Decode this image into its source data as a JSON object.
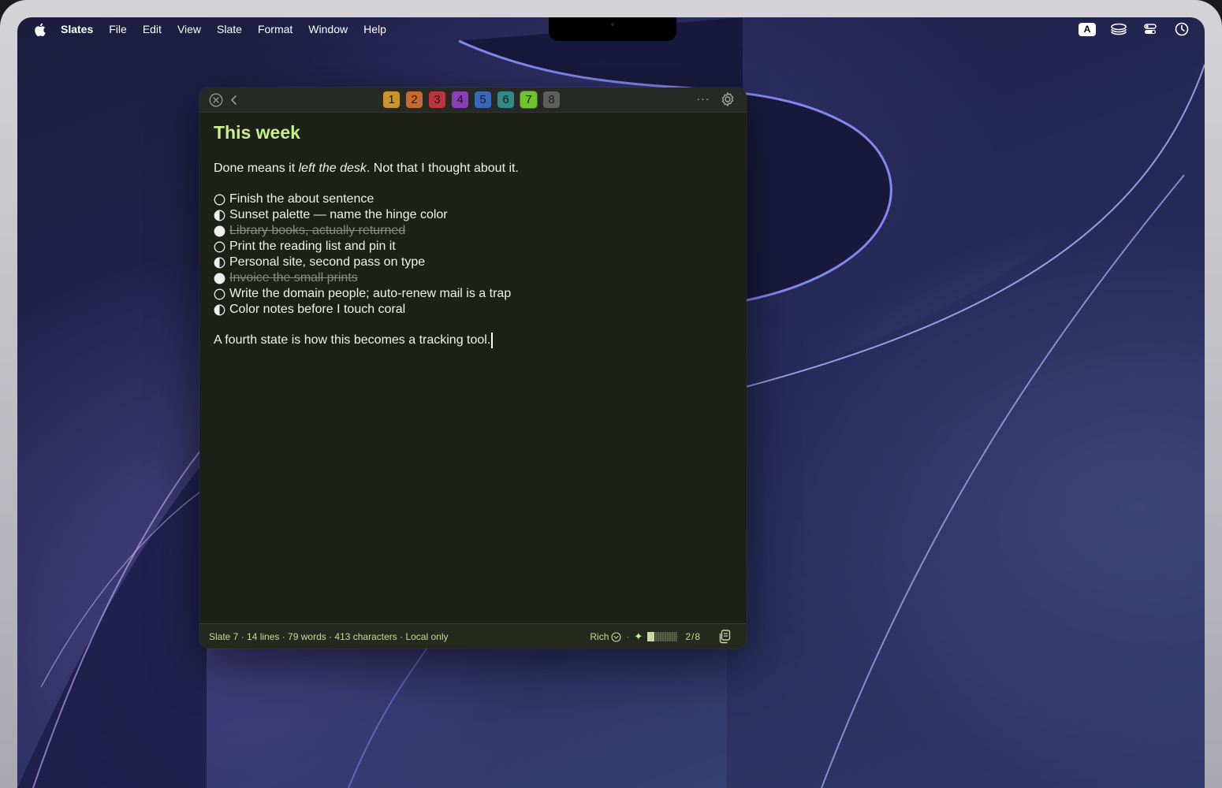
{
  "menubar": {
    "app_name": "Slates",
    "menus": [
      "File",
      "Edit",
      "View",
      "Slate",
      "Format",
      "Window",
      "Help"
    ],
    "keyboard_badge": "A"
  },
  "window": {
    "tabs": [
      {
        "label": "1",
        "color": "#c9942c"
      },
      {
        "label": "2",
        "color": "#c86a2e"
      },
      {
        "label": "3",
        "color": "#b8353c"
      },
      {
        "label": "4",
        "color": "#8b3fb6"
      },
      {
        "label": "5",
        "color": "#3a68b8"
      },
      {
        "label": "6",
        "color": "#2f8a8a"
      },
      {
        "label": "7",
        "color": "#6fc42c"
      },
      {
        "label": "8",
        "color": "#5e5e5e"
      }
    ],
    "active_tab": "7",
    "more_label": "···"
  },
  "note": {
    "title": "This week",
    "intro_before": "Done means it ",
    "intro_emphasis": "left the desk",
    "intro_after": ". Not that I thought about it.",
    "items": [
      {
        "text": "Finish the about sentence",
        "state": "empty"
      },
      {
        "text": "Sunset palette — name the hinge color",
        "state": "half"
      },
      {
        "text": "Library books, actually returned",
        "state": "done"
      },
      {
        "text": "Print the reading list and pin it",
        "state": "empty"
      },
      {
        "text": "Personal site, second pass on type",
        "state": "half"
      },
      {
        "text": "Invoice the small prints",
        "state": "done"
      },
      {
        "text": "Write the domain people; auto-renew mail is a trap",
        "state": "empty"
      },
      {
        "text": "Color notes before I touch coral",
        "state": "half"
      }
    ],
    "closing": "A fourth state is how this becomes a tracking tool."
  },
  "status": {
    "summary": "Slate 7 · 14 lines · 79 words · 413 characters · Local only",
    "mode": "Rich",
    "separator": "·",
    "sparkle": "✦",
    "fill_fraction": 0.25,
    "page_count": "2/8"
  },
  "colors": {
    "title_accent": "#c5f08a",
    "window_bg": "#1d2117",
    "status_text": "#c9d7a0"
  }
}
